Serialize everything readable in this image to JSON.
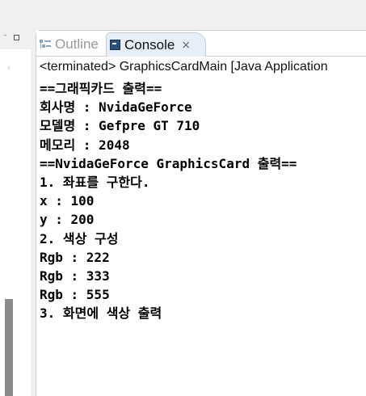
{
  "left_panel": {
    "controls": {
      "minimize_glyph": "⁻"
    }
  },
  "tabs": {
    "outline_label": "Outline",
    "console_label": "Console",
    "close_glyph": "×"
  },
  "console": {
    "status": "<terminated> GraphicsCardMain [Java Application",
    "lines": [
      {
        "text": "==그래픽카드 출력==",
        "bold": true
      },
      {
        "text": "회사명 : NvidaGeForce",
        "bold": true
      },
      {
        "text": "모델명 : Gefpre GT 710",
        "bold": true
      },
      {
        "text": "메모리 : 2048",
        "bold": true
      },
      {
        "text": "==NvidaGeForce GraphicsCard 출력==",
        "bold": true
      },
      {
        "text": "1. 좌표를 구한다.",
        "bold": true
      },
      {
        "text": "x : 100",
        "bold": true
      },
      {
        "text": "y : 200",
        "bold": true
      },
      {
        "text": "2. 색상 구성",
        "bold": true
      },
      {
        "text": "Rgb : 222",
        "bold": true
      },
      {
        "text": "Rgb : 333",
        "bold": true
      },
      {
        "text": "Rgb : 555",
        "bold": true
      },
      {
        "text": "3. 화면에 색상 출력",
        "bold": true
      }
    ]
  }
}
